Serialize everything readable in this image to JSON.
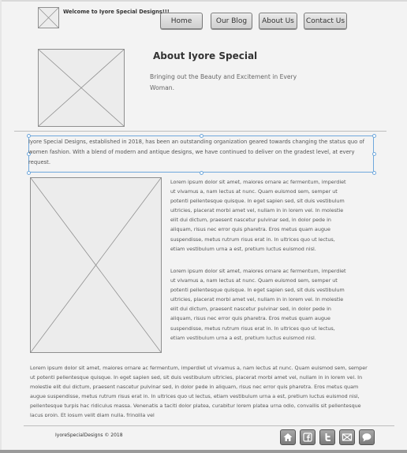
{
  "header": {
    "welcome_text": "Welcome to Iyore Special Designs!!!",
    "nav": [
      {
        "label": "Home"
      },
      {
        "label": "Our Blog"
      },
      {
        "label": "About Us"
      },
      {
        "label": "Contact Us"
      }
    ]
  },
  "about": {
    "title": "About Iyore Special",
    "subtitle": "Bringing out the Beauty and Excitement in Every Woman."
  },
  "intro": {
    "text": "Iyore Special Designs, established in 2018, has been an outstanding organization geared towards changing the status quo of women fashion. With a blend of modern and antique designs, we have continued to deliver on the gradest level, at every request."
  },
  "content": {
    "lorem_1": "Lorem ipsum dolor sit amet, maiores ornare ac fermentum, imperdiet ut vivamus a, nam lectus at nunc. Quam euismod sem, semper ut potenti pellentesque quisque. In eget sapien sed, sit duis vestibulum ultricies, placerat morbi amet vel, nullam in in lorem vel. In molestie elit dui dictum, praesent nascetur pulvinar sed, in dolor pede in aliquam, risus nec error quis pharetra. Eros metus quam augue suspendisse, metus rutrum risus erat in.  In ultrices quo ut lectus, etiam vestibulum urna a est, pretium luctus euismod nisl.",
    "lorem_2": "Lorem ipsum dolor sit amet, maiores ornare ac fermentum, imperdiet ut vivamus a, nam lectus at nunc. Quam euismod sem, semper ut potenti pellentesque quisque. In eget sapien sed, sit duis vestibulum ultricies, placerat morbi amet vel, nullam in in lorem vel. In molestie elit dui dictum, praesent nascetur pulvinar sed, in dolor pede in aliquam, risus nec error quis pharetra. Eros metus quam augue suspendisse, metus rutrum risus erat in.  In ultrices quo ut lectus, etiam vestibulum urna a est, pretium luctus euismod nisl.",
    "lorem_wide": "Lorem ipsum dolor sit amet, maiores ornare ac fermentum, imperdiet ut vivamus a, nam lectus at nunc. Quam euismod sem, semper ut potenti pellentesque quisque. In eget sapien sed, sit duis vestibulum ultricies, placerat morbi amet vel, nullam in in lorem vel. In molestie elit dui dictum, praesent nascetur pulvinar sed, in dolor pede in aliquam, risus nec error quis pharetra. Eros metus quam augue suspendisse, metus rutrum risus erat in.  In ultrices quo ut lectus, etiam vestibulum urna a est, pretium luctus euismod nisl, pellentesque turpis hac ridiculus massa. Venenatis a taciti dolor platea, curabitur lorem platea urna odio, convallis sit pellentesque lacus proin. Et iosum velit diam nulla, fringilla vel"
  },
  "footer": {
    "copyright": "IyoreSpecialDesigns © 2018",
    "social_icons": [
      "home-icon",
      "facebook-icon",
      "twitter-icon",
      "mail-icon",
      "chat-icon"
    ]
  },
  "colors": {
    "selection": "#6fa8dc",
    "background": "#f3f3f3",
    "social_button": "#8c8c8c"
  }
}
